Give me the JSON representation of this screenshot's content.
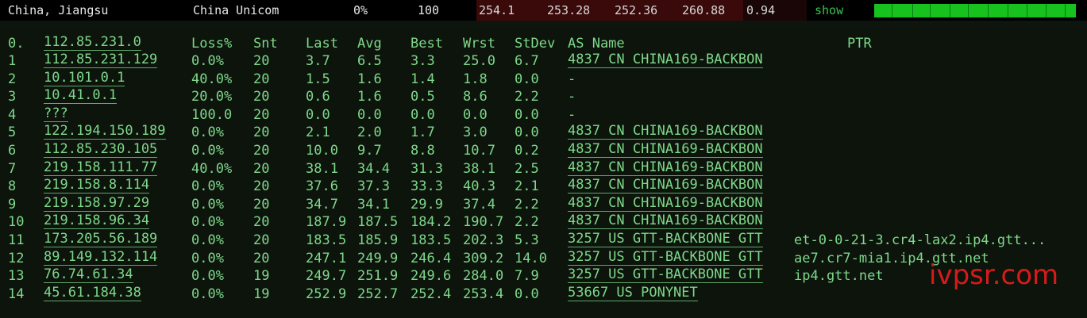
{
  "topbar": {
    "location": "China, Jiangsu",
    "isp": "China Unicom",
    "loss": "0%",
    "sent": "100",
    "last": "254.1",
    "avg": "253.28",
    "best": "252.36",
    "worst": "260.88",
    "stdev": "0.94",
    "show_label": "show",
    "red_colors": [
      "#3a0a0a",
      "#3a0a0a",
      "#3a0a0a",
      "#3a0a0a",
      "#1a0606"
    ]
  },
  "headers": {
    "hop": "0.",
    "ip": "112.85.231.0",
    "loss": "Loss%",
    "snt": "Snt",
    "last": "Last",
    "avg": "Avg",
    "best": "Best",
    "wrst": "Wrst",
    "stdev": "StDev",
    "as_name": "AS Name",
    "ptr": "PTR"
  },
  "hops": [
    {
      "hop": "1",
      "ip": "112.85.231.129",
      "loss": "0.0%",
      "snt": "20",
      "last": "3.7",
      "avg": "6.5",
      "best": "3.3",
      "wrst": "25.0",
      "stdev": "6.7",
      "as": "4837  CN CHINA169-BACKBON",
      "ptr": ""
    },
    {
      "hop": "2",
      "ip": "10.101.0.1",
      "loss": "40.0%",
      "snt": "20",
      "last": "1.5",
      "avg": "1.6",
      "best": "1.4",
      "wrst": "1.8",
      "stdev": "0.0",
      "as": "-",
      "ptr": ""
    },
    {
      "hop": "3",
      "ip": "10.41.0.1",
      "loss": "20.0%",
      "snt": "20",
      "last": "0.6",
      "avg": "1.6",
      "best": "0.5",
      "wrst": "8.6",
      "stdev": "2.2",
      "as": "-",
      "ptr": ""
    },
    {
      "hop": "4",
      "ip": "???",
      "loss": "100.0",
      "snt": "20",
      "last": "0.0",
      "avg": "0.0",
      "best": "0.0",
      "wrst": "0.0",
      "stdev": "0.0",
      "as": "-",
      "ptr": ""
    },
    {
      "hop": "5",
      "ip": "122.194.150.189",
      "loss": "0.0%",
      "snt": "20",
      "last": "2.1",
      "avg": "2.0",
      "best": "1.7",
      "wrst": "3.0",
      "stdev": "0.0",
      "as": "4837  CN CHINA169-BACKBON",
      "ptr": ""
    },
    {
      "hop": "6",
      "ip": "112.85.230.105",
      "loss": "0.0%",
      "snt": "20",
      "last": "10.0",
      "avg": "9.7",
      "best": "8.8",
      "wrst": "10.7",
      "stdev": "0.2",
      "as": "4837  CN CHINA169-BACKBON",
      "ptr": ""
    },
    {
      "hop": "7",
      "ip": "219.158.111.77",
      "loss": "40.0%",
      "snt": "20",
      "last": "38.1",
      "avg": "34.4",
      "best": "31.3",
      "wrst": "38.1",
      "stdev": "2.5",
      "as": "4837  CN CHINA169-BACKBON",
      "ptr": ""
    },
    {
      "hop": "8",
      "ip": "219.158.8.114",
      "loss": "0.0%",
      "snt": "20",
      "last": "37.6",
      "avg": "37.3",
      "best": "33.3",
      "wrst": "40.3",
      "stdev": "2.1",
      "as": "4837  CN CHINA169-BACKBON",
      "ptr": ""
    },
    {
      "hop": "9",
      "ip": "219.158.97.29",
      "loss": "0.0%",
      "snt": "20",
      "last": "34.7",
      "avg": "34.1",
      "best": "29.9",
      "wrst": "37.4",
      "stdev": "2.2",
      "as": "4837  CN CHINA169-BACKBON",
      "ptr": ""
    },
    {
      "hop": "10",
      "ip": "219.158.96.34",
      "loss": "0.0%",
      "snt": "20",
      "last": "187.9",
      "avg": "187.5",
      "best": "184.2",
      "wrst": "190.7",
      "stdev": "2.2",
      "as": "4837  CN CHINA169-BACKBON",
      "ptr": ""
    },
    {
      "hop": "11",
      "ip": "173.205.56.189",
      "loss": "0.0%",
      "snt": "20",
      "last": "183.5",
      "avg": "185.9",
      "best": "183.5",
      "wrst": "202.3",
      "stdev": "5.3",
      "as": "3257  US GTT-BACKBONE GTT",
      "ptr": "et-0-0-21-3.cr4-lax2.ip4.gtt..."
    },
    {
      "hop": "12",
      "ip": "89.149.132.114",
      "loss": "0.0%",
      "snt": "20",
      "last": "247.1",
      "avg": "249.9",
      "best": "246.4",
      "wrst": "309.2",
      "stdev": "14.0",
      "as": "3257  US GTT-BACKBONE GTT",
      "ptr": "ae7.cr7-mia1.ip4.gtt.net"
    },
    {
      "hop": "13",
      "ip": "76.74.61.34",
      "loss": "0.0%",
      "snt": "19",
      "last": "249.7",
      "avg": "251.9",
      "best": "249.6",
      "wrst": "284.0",
      "stdev": "7.9",
      "as": "3257  US GTT-BACKBONE GTT",
      "ptr": "ip4.gtt.net"
    },
    {
      "hop": "14",
      "ip": "45.61.184.38",
      "loss": "0.0%",
      "snt": "19",
      "last": "252.9",
      "avg": "252.7",
      "best": "252.4",
      "wrst": "253.4",
      "stdev": "0.0",
      "as": "53667 US PONYNET",
      "ptr": ""
    }
  ],
  "watermark": "ivpsr.com",
  "colors": {
    "terminal_bg": "#0c140c",
    "text": "#7fd88a",
    "bar": "#17c21f",
    "watermark": "#d81a1a"
  }
}
